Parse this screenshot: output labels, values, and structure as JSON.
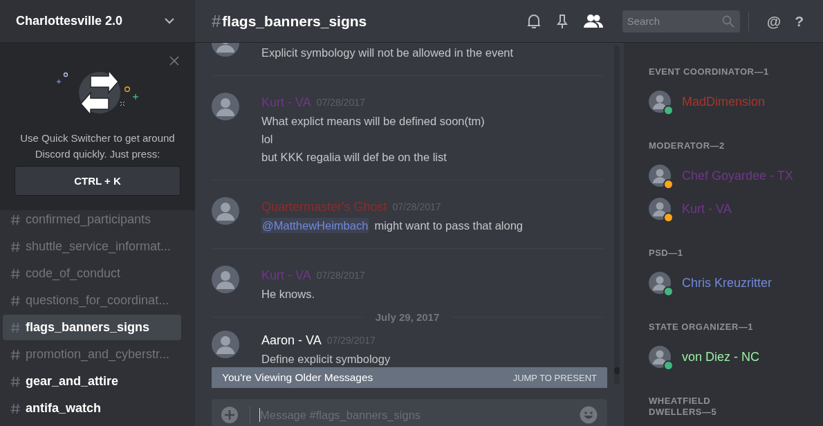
{
  "server": {
    "name": "Charlottesville 2.0"
  },
  "quick_switcher": {
    "text": "Use Quick Switcher to get around Discord quickly. Just press:",
    "shortcut": "CTRL + K"
  },
  "channels": [
    {
      "name": "confirmed_participants",
      "selected": false,
      "unread": false
    },
    {
      "name": "shuttle_service_informat...",
      "selected": false,
      "unread": false
    },
    {
      "name": "code_of_conduct",
      "selected": false,
      "unread": false
    },
    {
      "name": "questions_for_coordinat...",
      "selected": false,
      "unread": false
    },
    {
      "name": "flags_banners_signs",
      "selected": true,
      "unread": false
    },
    {
      "name": "promotion_and_cyberstr...",
      "selected": false,
      "unread": false
    },
    {
      "name": "gear_and_attire",
      "selected": false,
      "unread": true
    },
    {
      "name": "antifa_watch",
      "selected": false,
      "unread": true
    }
  ],
  "channel_header": {
    "hash": "#",
    "title": "flags_banners_signs",
    "search_placeholder": "Search",
    "mention_icon": "@",
    "help_icon": "?"
  },
  "messages": [
    {
      "kind": "message",
      "lines": [
        {
          "text": "Explicit symbology will not be allowed in the event"
        }
      ]
    },
    {
      "kind": "message",
      "author": "Kurt - VA",
      "color": "#71368a",
      "timestamp": "07/28/2017",
      "lines": [
        {
          "text": "What explict means will be defined soon(tm)"
        },
        {
          "text": "lol"
        },
        {
          "text": "but KKK regalia will def be on the list"
        }
      ]
    },
    {
      "kind": "message",
      "author": "Quartermaster's Ghost",
      "color": "#8e2c2c",
      "timestamp": "07/28/2017",
      "lines": [
        {
          "mention": "@MatthewHeimbach",
          "text": "might want to pass that along"
        }
      ]
    },
    {
      "kind": "message",
      "author": "Kurt - VA",
      "color": "#71368a",
      "timestamp": "07/28/2017",
      "lines": [
        {
          "text": "He knows."
        }
      ]
    },
    {
      "kind": "date_divider",
      "text": "July 29, 2017"
    },
    {
      "kind": "message",
      "author": "Aaron - VA",
      "color": "#ffffff",
      "timestamp": "07/29/2017",
      "lines": [
        {
          "text": "Define explicit symbology"
        }
      ]
    }
  ],
  "older_banner": {
    "text": "You're Viewing Older Messages",
    "action": "JUMP TO PRESENT"
  },
  "composer": {
    "placeholder": "Message #flags_banners_signs"
  },
  "member_groups": [
    {
      "heading": "EVENT COORDINATOR—1",
      "members": [
        {
          "name": "MadDimension",
          "color": "#a8352c",
          "idle": false
        }
      ]
    },
    {
      "heading": "MODERATOR—2",
      "members": [
        {
          "name": "Chef Goyardee - TX",
          "color": "#71368a",
          "idle": true
        },
        {
          "name": "Kurt - VA",
          "color": "#71368a",
          "idle": true
        }
      ]
    },
    {
      "heading": "PSD—1",
      "members": [
        {
          "name": "Chris Kreuzritter",
          "color": "#7289da",
          "idle": false
        }
      ]
    },
    {
      "heading": "STATE ORGANIZER—1",
      "members": [
        {
          "name": "von Diez - NC",
          "color": "#9af0a3",
          "idle": false
        }
      ]
    },
    {
      "heading": "WHEATFIELD\nDWELLERS—5"
    }
  ]
}
